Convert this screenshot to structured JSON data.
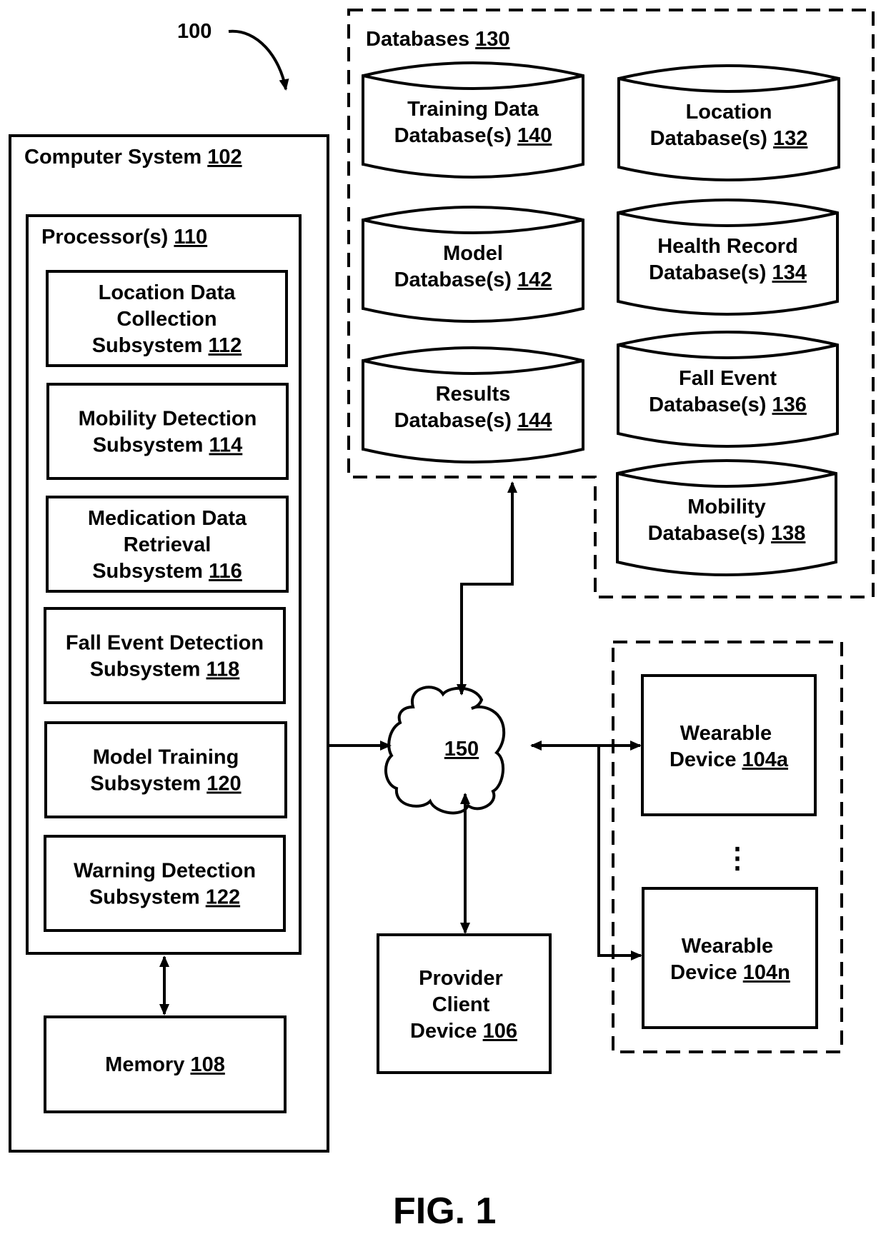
{
  "figure": {
    "reference_number": "100",
    "caption": "FIG. 1"
  },
  "computer_system": {
    "title": "Computer System",
    "ref": "102",
    "processor": {
      "title": "Processor(s)",
      "ref": "110",
      "subsystems": [
        {
          "lines": [
            "Location Data",
            "Collection",
            "Subsystem"
          ],
          "ref": "112"
        },
        {
          "lines": [
            "Mobility Detection",
            "Subsystem"
          ],
          "ref": "114"
        },
        {
          "lines": [
            "Medication Data",
            "Retrieval",
            "Subsystem"
          ],
          "ref": "116"
        },
        {
          "lines": [
            "Fall Event Detection",
            "Subsystem"
          ],
          "ref": "118"
        },
        {
          "lines": [
            "Model Training",
            "Subsystem"
          ],
          "ref": "120"
        },
        {
          "lines": [
            "Warning Detection",
            "Subsystem"
          ],
          "ref": "122"
        }
      ]
    },
    "memory": {
      "title": "Memory",
      "ref": "108"
    }
  },
  "databases": {
    "title": "Databases",
    "ref": "130",
    "items": [
      {
        "lines": [
          "Training Data",
          "Database(s)"
        ],
        "ref": "140"
      },
      {
        "lines": [
          "Model",
          "Database(s)"
        ],
        "ref": "142"
      },
      {
        "lines": [
          "Results",
          "Database(s)"
        ],
        "ref": "144"
      },
      {
        "lines": [
          "Location",
          "Database(s)"
        ],
        "ref": "132"
      },
      {
        "lines": [
          "Health Record",
          "Database(s)"
        ],
        "ref": "134"
      },
      {
        "lines": [
          "Fall Event",
          "Database(s)"
        ],
        "ref": "136"
      },
      {
        "lines": [
          "Mobility",
          "Database(s)"
        ],
        "ref": "138"
      }
    ]
  },
  "network": {
    "ref": "150"
  },
  "provider_client": {
    "lines": [
      "Provider",
      "Client",
      "Device"
    ],
    "ref": "106"
  },
  "wearables": {
    "items": [
      {
        "lines": [
          "Wearable",
          "Device"
        ],
        "ref": "104a"
      },
      {
        "lines": [
          "Wearable",
          "Device"
        ],
        "ref": "104n"
      }
    ],
    "ellipsis": "⋮"
  }
}
